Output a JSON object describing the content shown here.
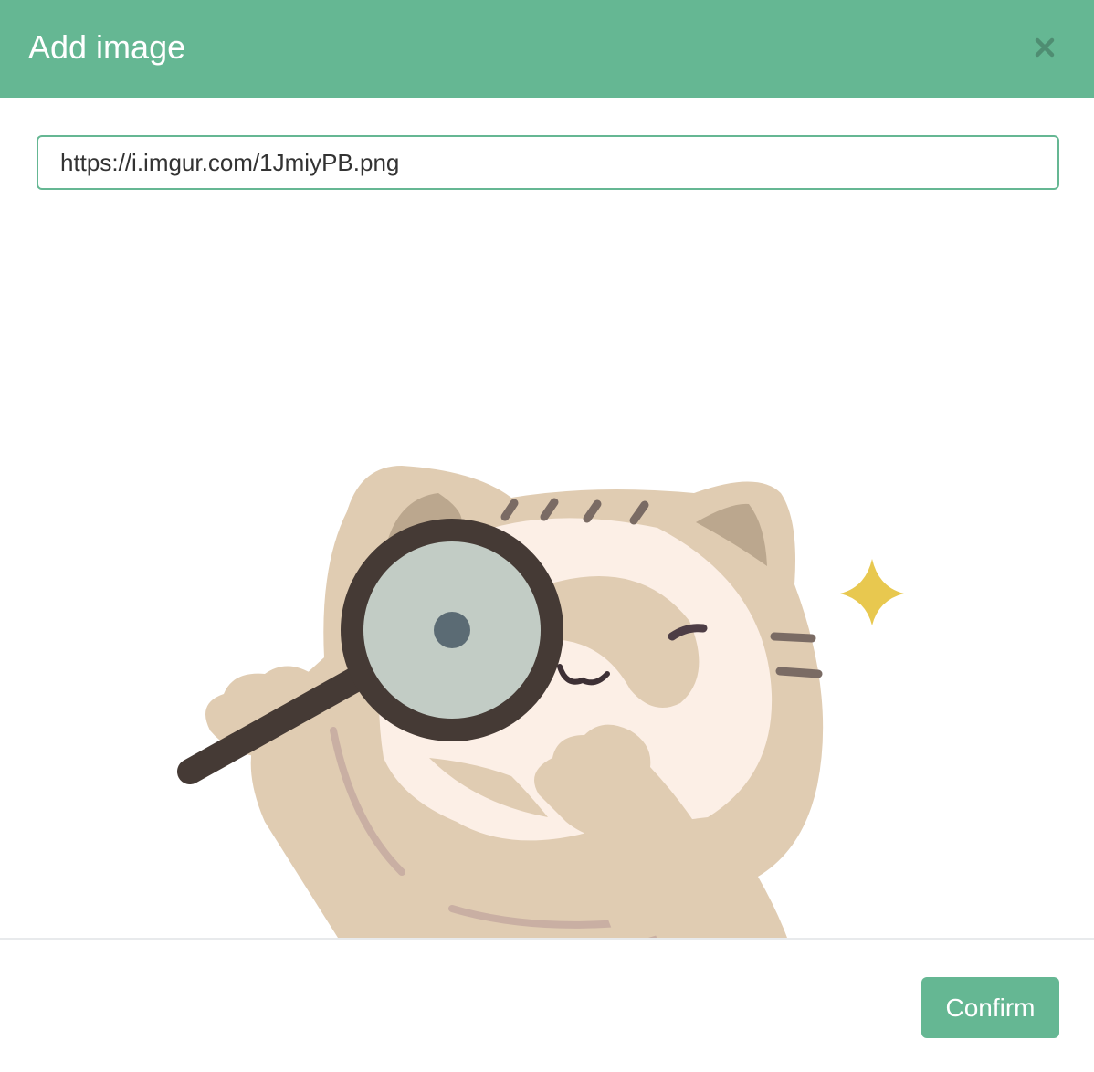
{
  "dialog": {
    "title": "Add image",
    "close_icon": "close-icon"
  },
  "url_input": {
    "value": "https://i.imgur.com/1JmiyPB.png"
  },
  "preview": {
    "image": "cat-with-magnifying-glass-illustration"
  },
  "footer": {
    "confirm_label": "Confirm"
  },
  "colors": {
    "accent": "#65b793",
    "header_text": "#ffffff",
    "close_icon": "#4f8d72",
    "cat_body": "#e0ccb2",
    "cat_belly": "#fcefe6",
    "lens": "#c2ccc5",
    "magnifier_frame": "#453a35",
    "sparkle": "#e8c84f"
  }
}
